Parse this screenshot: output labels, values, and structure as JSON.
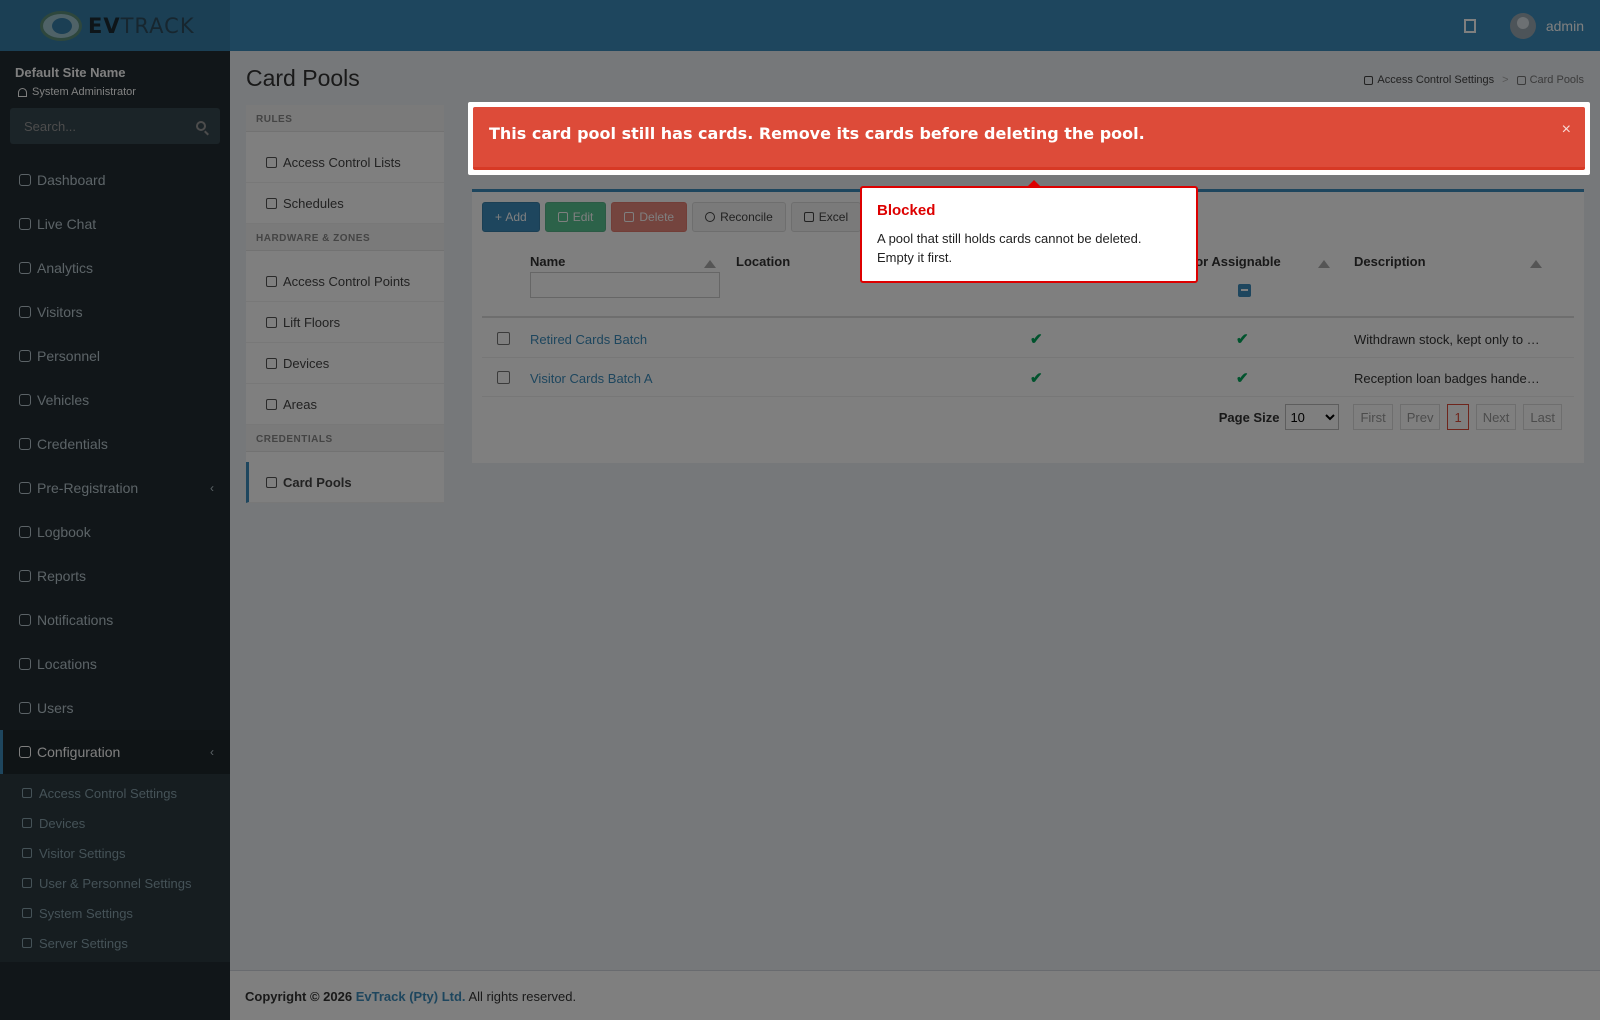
{
  "header": {
    "logo_text_bold": "EV",
    "logo_text_rest": "TRACK",
    "user_name": "admin"
  },
  "sidebar": {
    "site_name": "Default Site Name",
    "role": "System Administrator",
    "search_placeholder": "Search...",
    "items": [
      {
        "label": "Dashboard",
        "icon": "dashboard-icon"
      },
      {
        "label": "Live Chat",
        "icon": "headset-icon"
      },
      {
        "label": "Analytics",
        "icon": "analytics-icon"
      },
      {
        "label": "Visitors",
        "icon": "eye-icon"
      },
      {
        "label": "Personnel",
        "icon": "personnel-icon"
      },
      {
        "label": "Vehicles",
        "icon": "car-icon"
      },
      {
        "label": "Credentials",
        "icon": "credentials-icon"
      },
      {
        "label": "Pre-Registration",
        "icon": "transfer-icon"
      },
      {
        "label": "Logbook",
        "icon": "book-icon"
      },
      {
        "label": "Reports",
        "icon": "reports-icon"
      },
      {
        "label": "Notifications",
        "icon": "notifications-icon"
      },
      {
        "label": "Locations",
        "icon": "building-icon"
      },
      {
        "label": "Users",
        "icon": "users-icon"
      },
      {
        "label": "Configuration",
        "icon": "gear-icon"
      }
    ],
    "sub_items": [
      {
        "label": "Access Control Settings",
        "icon": "lock-icon"
      },
      {
        "label": "Devices",
        "icon": "device-icon"
      },
      {
        "label": "Visitor Settings",
        "icon": "eye-icon"
      },
      {
        "label": "User & Personnel Settings",
        "icon": "user-settings-icon"
      },
      {
        "label": "System Settings",
        "icon": "sliders-icon"
      },
      {
        "label": "Server Settings",
        "icon": "server-icon"
      }
    ]
  },
  "page": {
    "title": "Card Pools",
    "breadcrumb_parent": "Access Control Settings",
    "breadcrumb_current": "Card Pools"
  },
  "settings_menu": {
    "rules_header": "RULES",
    "rules": [
      "Access Control Lists",
      "Schedules"
    ],
    "hardware_header": "HARDWARE & ZONES",
    "hardware": [
      "Access Control Points",
      "Lift Floors",
      "Devices",
      "Areas"
    ],
    "credentials_header": "CREDENTIALS",
    "credentials": [
      "Card Pools"
    ]
  },
  "toolbar": {
    "add": "Add",
    "edit": "Edit",
    "delete": "Delete",
    "reconcile": "Reconcile",
    "excel": "Excel"
  },
  "grid": {
    "columns": {
      "name": "Name",
      "location": "Location",
      "visitor_assignable": "Visitor Assignable",
      "description": "Description"
    },
    "rows": [
      {
        "name": "Retired Cards Batch",
        "col3": true,
        "visitor_assignable": true,
        "description": "Withdrawn stock, kept only to …"
      },
      {
        "name": "Visitor Cards Batch A",
        "col3": true,
        "visitor_assignable": true,
        "description": "Reception loan badges hande…"
      }
    ],
    "check_glyph": "✔",
    "page_size_label": "Page Size",
    "page_size": "10",
    "pager": {
      "first": "First",
      "prev": "Prev",
      "page": "1",
      "next": "Next",
      "last": "Last"
    }
  },
  "footer": {
    "copyright": "Copyright © 2026",
    "company": "EvTrack (Pty) Ltd.",
    "rights": "All rights reserved."
  },
  "alert": {
    "message": "This card pool still has cards. Remove its cards before deleting the pool.",
    "close": "×"
  },
  "tooltip": {
    "title": "Blocked",
    "body": "A pool that still holds cards cannot be deleted. Empty it first."
  },
  "colors": {
    "header": "#3c8dbc",
    "sidebar": "#222d32",
    "alert": "#dd4b39",
    "success": "#00a65a",
    "tooltip_border": "#dd0000"
  }
}
